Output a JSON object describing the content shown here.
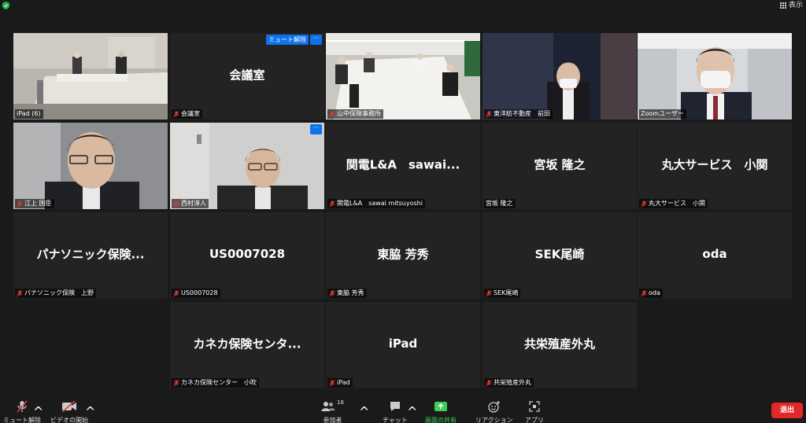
{
  "topbar": {
    "view_label": "表示"
  },
  "tiles": [
    {
      "id": "t1",
      "name": "iPad (6)",
      "center": "",
      "video": true
    },
    {
      "id": "t2",
      "name": "会議室",
      "center": "会議室",
      "video": false,
      "unmute_label": "ミュート解除",
      "more_label": "···"
    },
    {
      "id": "t3",
      "name": "山中保険事務所",
      "center": "",
      "video": true
    },
    {
      "id": "t4",
      "name": "東洋紡不動産　前田",
      "center": "",
      "video": true
    },
    {
      "id": "t5",
      "name": "Zoomユーザー",
      "center": "",
      "video": true,
      "active": true
    },
    {
      "id": "t6",
      "name": "江上 国臣",
      "center": "",
      "video": true
    },
    {
      "id": "t7",
      "name": "西村淳人",
      "center": "",
      "video": true,
      "more_label": "···"
    },
    {
      "id": "t8",
      "name": "関電L&A　sawai mitsuyoshi",
      "center": "関電L&A　sawai...",
      "video": false
    },
    {
      "id": "t9",
      "name": "宮坂 隆之",
      "center": "宮坂 隆之",
      "video": false
    },
    {
      "id": "t10",
      "name": "丸大サービス　小関",
      "center": "丸大サービス　小関",
      "video": false
    },
    {
      "id": "t11",
      "name": "パナソニック保険　上野",
      "center": "パナソニック保険...",
      "video": false
    },
    {
      "id": "t12",
      "name": "US0007028",
      "center": "US0007028",
      "video": false
    },
    {
      "id": "t13",
      "name": "東脇 芳秀",
      "center": "東脇 芳秀",
      "video": false
    },
    {
      "id": "t14",
      "name": "SEK尾崎",
      "center": "SEK尾崎",
      "video": false
    },
    {
      "id": "t15",
      "name": "oda",
      "center": "oda",
      "video": false
    },
    {
      "id": "t16",
      "name": "カネカ保険センター　小吹",
      "center": "カネカ保険センタ...",
      "video": false
    },
    {
      "id": "t17",
      "name": "iPad",
      "center": "iPad",
      "video": false
    },
    {
      "id": "t18",
      "name": "共栄殖産外丸",
      "center": "共栄殖産外丸",
      "video": false
    }
  ],
  "toolbar": {
    "unmute": "ミュート解除",
    "start_video": "ビデオの開始",
    "participants": "参加者",
    "participants_count": "18",
    "chat": "チャット",
    "share": "画面の共有",
    "reactions": "リアクション",
    "apps": "アプリ",
    "leave": "退出"
  },
  "colors": {
    "accent": "#0e72ed",
    "active_speaker": "#c6d85a",
    "leave": "#e02828",
    "share": "#3ccf5a",
    "tile_bg": "#232323"
  }
}
